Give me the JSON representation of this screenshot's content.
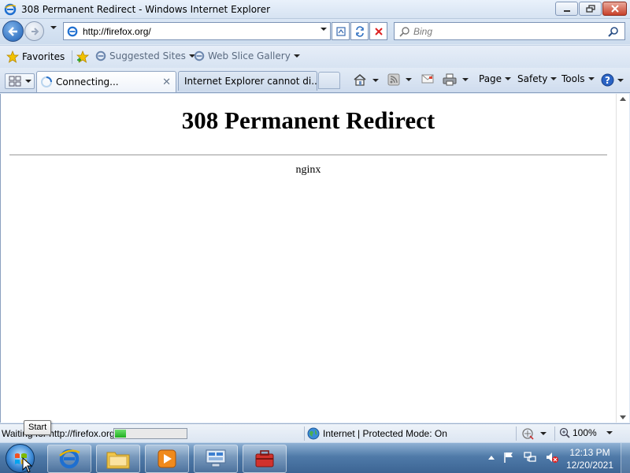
{
  "window": {
    "title": "308 Permanent Redirect - Windows Internet Explorer"
  },
  "address_bar": {
    "url": "http://firefox.org/",
    "search_placeholder": "Bing"
  },
  "favorites_bar": {
    "favorites_label": "Favorites",
    "items": [
      "Suggested Sites",
      "Web Slice Gallery"
    ]
  },
  "tabs": [
    {
      "label": "Connecting...",
      "state": "active"
    },
    {
      "label": "Internet Explorer cannot di...",
      "state": "inactive"
    }
  ],
  "command_bar": {
    "page_label": "Page",
    "safety_label": "Safety",
    "tools_label": "Tools"
  },
  "page": {
    "heading": "308 Permanent Redirect",
    "server": "nginx"
  },
  "status_bar": {
    "status_text": "Waiting for http://firefox.org/...",
    "progress": 0.15,
    "zone": "Internet | Protected Mode: On",
    "zoom": "100%",
    "tooltip": "Start"
  },
  "taskbar": {
    "time": "12:13 PM",
    "date": "12/20/2021",
    "apps": [
      "internet-explorer",
      "windows-explorer",
      "media-player",
      "control-panel",
      "toolbox"
    ]
  },
  "colors": {
    "accent": "#1c5fb5",
    "progress": "#1fae1f",
    "close_button": "#c8412a"
  }
}
